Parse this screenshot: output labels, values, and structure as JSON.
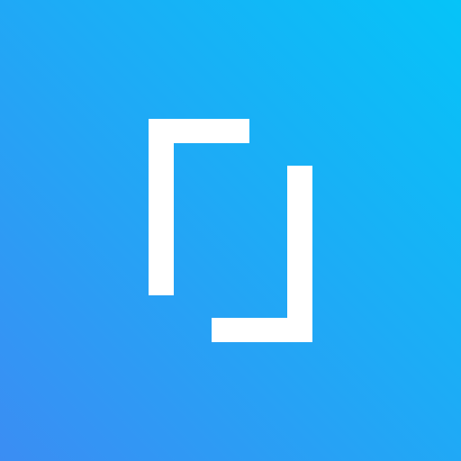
{
  "icon": {
    "name": "bracket-frame-logo",
    "colors": {
      "gradient_top_right": "#05c4f8",
      "gradient_bottom_left": "#3b8df3",
      "glyph": "#ffffff"
    }
  }
}
